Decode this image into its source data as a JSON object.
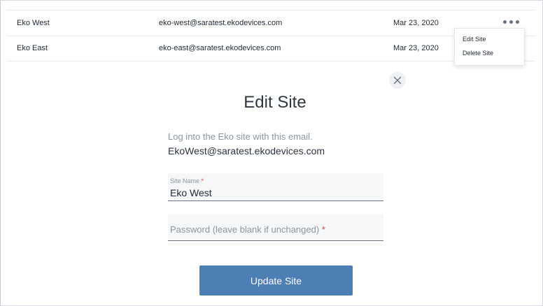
{
  "table": {
    "rows": [
      {
        "name": "Eko West",
        "email": "eko-west@saratest.ekodevices.com",
        "date": "Mar 23, 2020"
      },
      {
        "name": "Eko East",
        "email": "eko-east@saratest.ekodevices.com",
        "date": "Mar 23, 2020"
      }
    ],
    "more_icon": "more-horizontal-icon"
  },
  "menu": {
    "items": [
      "Edit Site",
      "Delete Site"
    ]
  },
  "modal": {
    "close_icon": "close-icon",
    "title": "Edit Site",
    "hint": "Log into the Eko site with this email.",
    "email": "EkoWest@saratest.ekodevices.com",
    "site_name": {
      "label": "Site Name",
      "required_mark": "*",
      "value": "Eko West"
    },
    "password": {
      "placeholder": "Password (leave blank if unchanged)",
      "required_mark": "*"
    },
    "submit_label": "Update Site"
  },
  "colors": {
    "primary_button": "#4d7eb4",
    "required": "#d64545"
  }
}
